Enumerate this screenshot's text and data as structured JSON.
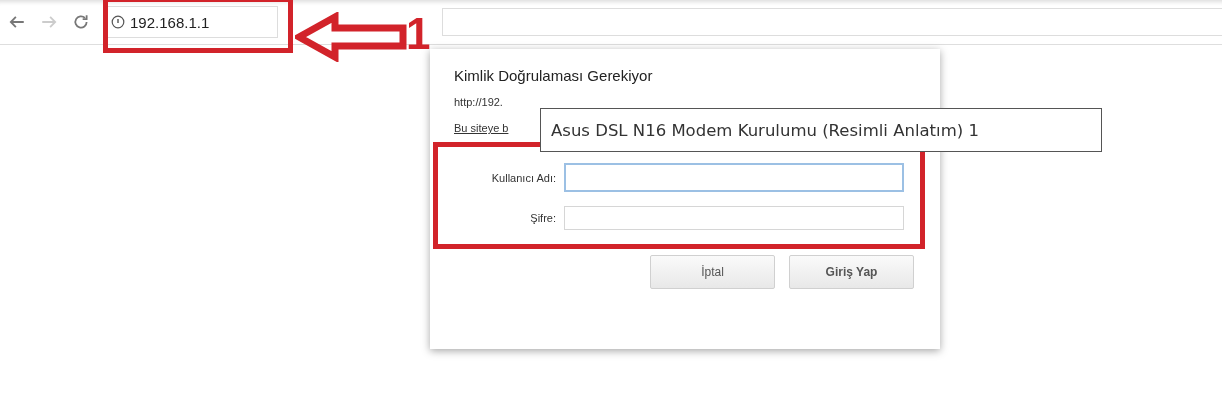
{
  "toolbar": {
    "nav_buttons": [
      {
        "kind": "back",
        "disabled": false
      },
      {
        "kind": "forward",
        "disabled": true
      },
      {
        "kind": "reload",
        "disabled": false
      }
    ],
    "address": "192.168.1.1"
  },
  "annotation": {
    "label": "1"
  },
  "dialog": {
    "title": "Kimlik Doğrulaması Gerekiyor",
    "url_text": "http://192.",
    "message": "Bu siteye b",
    "fields": [
      {
        "label": "Kullanıcı Adı:",
        "focused": true
      },
      {
        "label": "Şifre:",
        "focused": false
      }
    ],
    "buttons": [
      "İptal",
      "Giriş Yap"
    ]
  },
  "tooltip": {
    "text": "Asus DSL N16 Modem Kurulumu (Resimli Anlatım) 1"
  }
}
